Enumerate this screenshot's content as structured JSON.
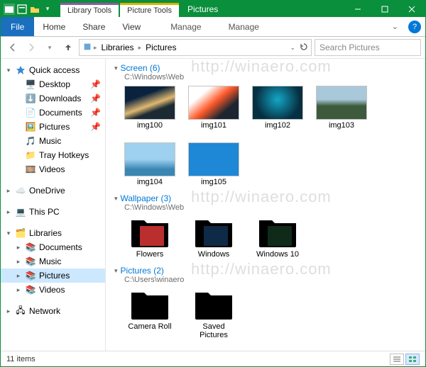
{
  "titlebar": {
    "context_tabs": [
      {
        "label": "Library Tools"
      },
      {
        "label": "Picture Tools"
      }
    ],
    "title": "Pictures"
  },
  "ribbon": {
    "file": "File",
    "tabs": [
      "Home",
      "Share",
      "View"
    ],
    "context_tabs": [
      "Manage",
      "Manage"
    ]
  },
  "address": {
    "crumbs": [
      "Libraries",
      "Pictures"
    ]
  },
  "search": {
    "placeholder": "Search Pictures"
  },
  "sidebar": {
    "quick_access": {
      "label": "Quick access",
      "items": [
        {
          "label": "Desktop",
          "pinned": true
        },
        {
          "label": "Downloads",
          "pinned": true
        },
        {
          "label": "Documents",
          "pinned": true
        },
        {
          "label": "Pictures",
          "pinned": true
        },
        {
          "label": "Music"
        },
        {
          "label": "Tray Hotkeys"
        },
        {
          "label": "Videos"
        }
      ]
    },
    "onedrive": {
      "label": "OneDrive"
    },
    "this_pc": {
      "label": "This PC"
    },
    "libraries": {
      "label": "Libraries",
      "items": [
        {
          "label": "Documents"
        },
        {
          "label": "Music"
        },
        {
          "label": "Pictures",
          "selected": true
        },
        {
          "label": "Videos"
        }
      ]
    },
    "network": {
      "label": "Network"
    }
  },
  "content": {
    "groups": [
      {
        "title": "Screen",
        "count": 6,
        "path": "C:\\Windows\\Web",
        "items": [
          {
            "type": "image",
            "label": "img100",
            "variant": "a"
          },
          {
            "type": "image",
            "label": "img101",
            "variant": "b"
          },
          {
            "type": "image",
            "label": "img102",
            "variant": "c"
          },
          {
            "type": "image",
            "label": "img103",
            "variant": "d"
          },
          {
            "type": "image",
            "label": "img104",
            "variant": "e"
          },
          {
            "type": "image",
            "label": "img105",
            "variant": "f"
          }
        ]
      },
      {
        "title": "Wallpaper",
        "count": 3,
        "path": "C:\\Windows\\Web",
        "items": [
          {
            "type": "folder",
            "label": "Flowers",
            "variant": "flowers"
          },
          {
            "type": "folder",
            "label": "Windows",
            "variant": "win"
          },
          {
            "type": "folder",
            "label": "Windows 10",
            "variant": "w10"
          }
        ]
      },
      {
        "title": "Pictures",
        "count": 2,
        "path": "C:\\Users\\winaero",
        "items": [
          {
            "type": "folder",
            "label": "Camera Roll",
            "variant": "plain"
          },
          {
            "type": "folder",
            "label": "Saved Pictures",
            "variant": "plain"
          }
        ]
      }
    ]
  },
  "status": {
    "text": "11 items"
  },
  "watermark": "http://winaero.com"
}
